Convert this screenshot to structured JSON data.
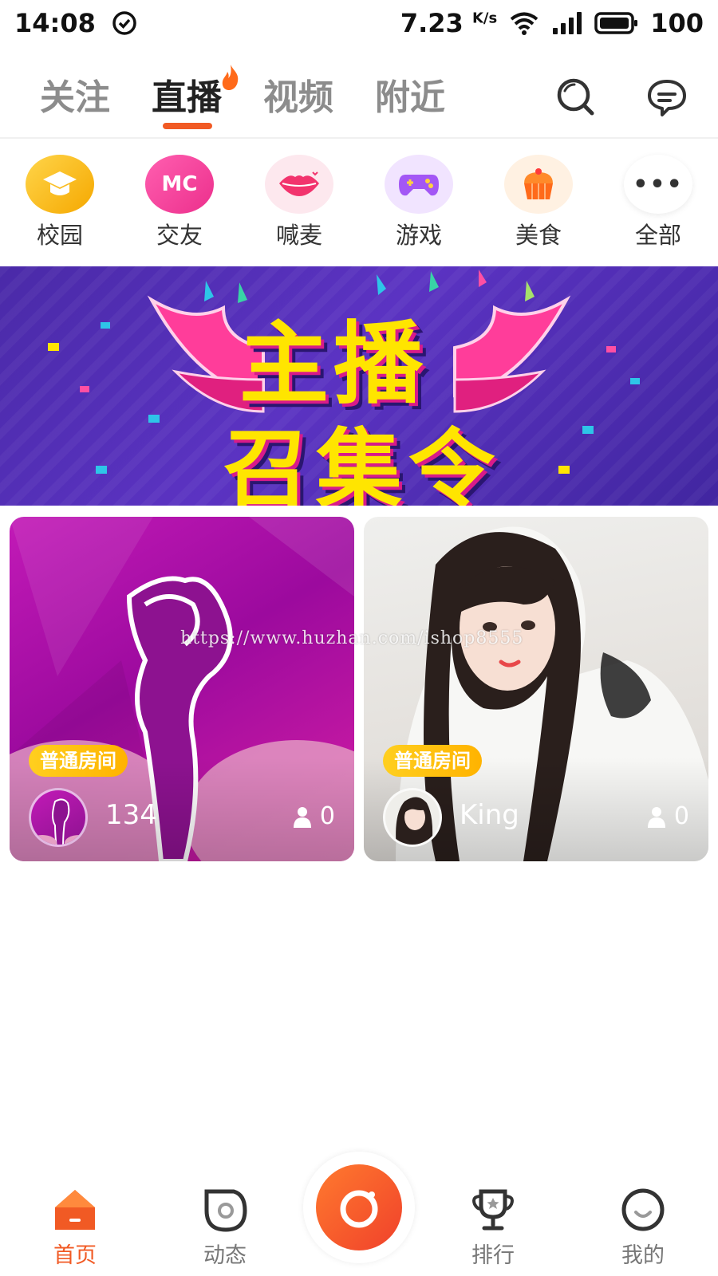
{
  "status_bar": {
    "time": "14:08",
    "speed_value": "7.23",
    "speed_unit": "K/s",
    "battery": "100"
  },
  "top_nav": {
    "tabs": [
      {
        "label": "关注",
        "active": false
      },
      {
        "label": "直播",
        "active": true
      },
      {
        "label": "视频",
        "active": false
      },
      {
        "label": "附近",
        "active": false
      }
    ],
    "accent_color": "#f15a24"
  },
  "categories": [
    {
      "label": "校园",
      "icon": "graduation-cap-icon",
      "badge": ""
    },
    {
      "label": "交友",
      "icon": "mc-icon",
      "badge": "MC"
    },
    {
      "label": "喊麦",
      "icon": "lips-icon",
      "badge": ""
    },
    {
      "label": "游戏",
      "icon": "gamepad-icon",
      "badge": ""
    },
    {
      "label": "美食",
      "icon": "cake-icon",
      "badge": ""
    },
    {
      "label": "全部",
      "icon": "more-icon",
      "badge": "•••"
    }
  ],
  "banner": {
    "title_line1": "主播",
    "title_line2": "召集令"
  },
  "live_rooms": [
    {
      "room_type": "普通房间",
      "name": "134",
      "viewers": "0"
    },
    {
      "room_type": "普通房间",
      "name": "King",
      "viewers": "0"
    }
  ],
  "watermark": "https://www.huzhan.com/ishop8555",
  "bottom_nav": {
    "items": [
      {
        "label": "首页",
        "active": true
      },
      {
        "label": "动态",
        "active": false
      },
      {
        "label": "排行",
        "active": false
      },
      {
        "label": "我的",
        "active": false
      }
    ],
    "center_button": "camera-icon"
  }
}
